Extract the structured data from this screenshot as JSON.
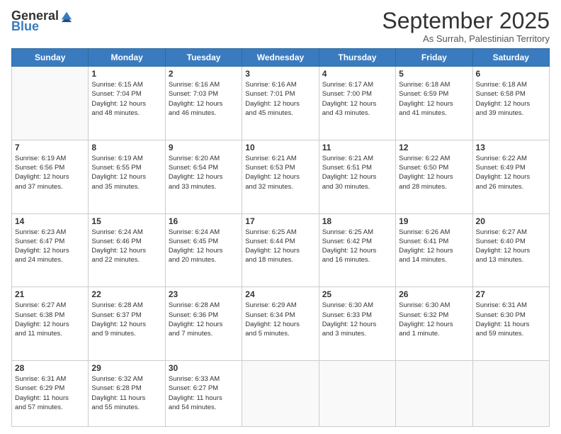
{
  "header": {
    "logo_general": "General",
    "logo_blue": "Blue",
    "month_title": "September 2025",
    "location": "As Surrah, Palestinian Territory"
  },
  "weekdays": [
    "Sunday",
    "Monday",
    "Tuesday",
    "Wednesday",
    "Thursday",
    "Friday",
    "Saturday"
  ],
  "weeks": [
    [
      {
        "day": "",
        "info": ""
      },
      {
        "day": "1",
        "info": "Sunrise: 6:15 AM\nSunset: 7:04 PM\nDaylight: 12 hours\nand 48 minutes."
      },
      {
        "day": "2",
        "info": "Sunrise: 6:16 AM\nSunset: 7:03 PM\nDaylight: 12 hours\nand 46 minutes."
      },
      {
        "day": "3",
        "info": "Sunrise: 6:16 AM\nSunset: 7:01 PM\nDaylight: 12 hours\nand 45 minutes."
      },
      {
        "day": "4",
        "info": "Sunrise: 6:17 AM\nSunset: 7:00 PM\nDaylight: 12 hours\nand 43 minutes."
      },
      {
        "day": "5",
        "info": "Sunrise: 6:18 AM\nSunset: 6:59 PM\nDaylight: 12 hours\nand 41 minutes."
      },
      {
        "day": "6",
        "info": "Sunrise: 6:18 AM\nSunset: 6:58 PM\nDaylight: 12 hours\nand 39 minutes."
      }
    ],
    [
      {
        "day": "7",
        "info": "Sunrise: 6:19 AM\nSunset: 6:56 PM\nDaylight: 12 hours\nand 37 minutes."
      },
      {
        "day": "8",
        "info": "Sunrise: 6:19 AM\nSunset: 6:55 PM\nDaylight: 12 hours\nand 35 minutes."
      },
      {
        "day": "9",
        "info": "Sunrise: 6:20 AM\nSunset: 6:54 PM\nDaylight: 12 hours\nand 33 minutes."
      },
      {
        "day": "10",
        "info": "Sunrise: 6:21 AM\nSunset: 6:53 PM\nDaylight: 12 hours\nand 32 minutes."
      },
      {
        "day": "11",
        "info": "Sunrise: 6:21 AM\nSunset: 6:51 PM\nDaylight: 12 hours\nand 30 minutes."
      },
      {
        "day": "12",
        "info": "Sunrise: 6:22 AM\nSunset: 6:50 PM\nDaylight: 12 hours\nand 28 minutes."
      },
      {
        "day": "13",
        "info": "Sunrise: 6:22 AM\nSunset: 6:49 PM\nDaylight: 12 hours\nand 26 minutes."
      }
    ],
    [
      {
        "day": "14",
        "info": "Sunrise: 6:23 AM\nSunset: 6:47 PM\nDaylight: 12 hours\nand 24 minutes."
      },
      {
        "day": "15",
        "info": "Sunrise: 6:24 AM\nSunset: 6:46 PM\nDaylight: 12 hours\nand 22 minutes."
      },
      {
        "day": "16",
        "info": "Sunrise: 6:24 AM\nSunset: 6:45 PM\nDaylight: 12 hours\nand 20 minutes."
      },
      {
        "day": "17",
        "info": "Sunrise: 6:25 AM\nSunset: 6:44 PM\nDaylight: 12 hours\nand 18 minutes."
      },
      {
        "day": "18",
        "info": "Sunrise: 6:25 AM\nSunset: 6:42 PM\nDaylight: 12 hours\nand 16 minutes."
      },
      {
        "day": "19",
        "info": "Sunrise: 6:26 AM\nSunset: 6:41 PM\nDaylight: 12 hours\nand 14 minutes."
      },
      {
        "day": "20",
        "info": "Sunrise: 6:27 AM\nSunset: 6:40 PM\nDaylight: 12 hours\nand 13 minutes."
      }
    ],
    [
      {
        "day": "21",
        "info": "Sunrise: 6:27 AM\nSunset: 6:38 PM\nDaylight: 12 hours\nand 11 minutes."
      },
      {
        "day": "22",
        "info": "Sunrise: 6:28 AM\nSunset: 6:37 PM\nDaylight: 12 hours\nand 9 minutes."
      },
      {
        "day": "23",
        "info": "Sunrise: 6:28 AM\nSunset: 6:36 PM\nDaylight: 12 hours\nand 7 minutes."
      },
      {
        "day": "24",
        "info": "Sunrise: 6:29 AM\nSunset: 6:34 PM\nDaylight: 12 hours\nand 5 minutes."
      },
      {
        "day": "25",
        "info": "Sunrise: 6:30 AM\nSunset: 6:33 PM\nDaylight: 12 hours\nand 3 minutes."
      },
      {
        "day": "26",
        "info": "Sunrise: 6:30 AM\nSunset: 6:32 PM\nDaylight: 12 hours\nand 1 minute."
      },
      {
        "day": "27",
        "info": "Sunrise: 6:31 AM\nSunset: 6:30 PM\nDaylight: 11 hours\nand 59 minutes."
      }
    ],
    [
      {
        "day": "28",
        "info": "Sunrise: 6:31 AM\nSunset: 6:29 PM\nDaylight: 11 hours\nand 57 minutes."
      },
      {
        "day": "29",
        "info": "Sunrise: 6:32 AM\nSunset: 6:28 PM\nDaylight: 11 hours\nand 55 minutes."
      },
      {
        "day": "30",
        "info": "Sunrise: 6:33 AM\nSunset: 6:27 PM\nDaylight: 11 hours\nand 54 minutes."
      },
      {
        "day": "",
        "info": ""
      },
      {
        "day": "",
        "info": ""
      },
      {
        "day": "",
        "info": ""
      },
      {
        "day": "",
        "info": ""
      }
    ]
  ]
}
